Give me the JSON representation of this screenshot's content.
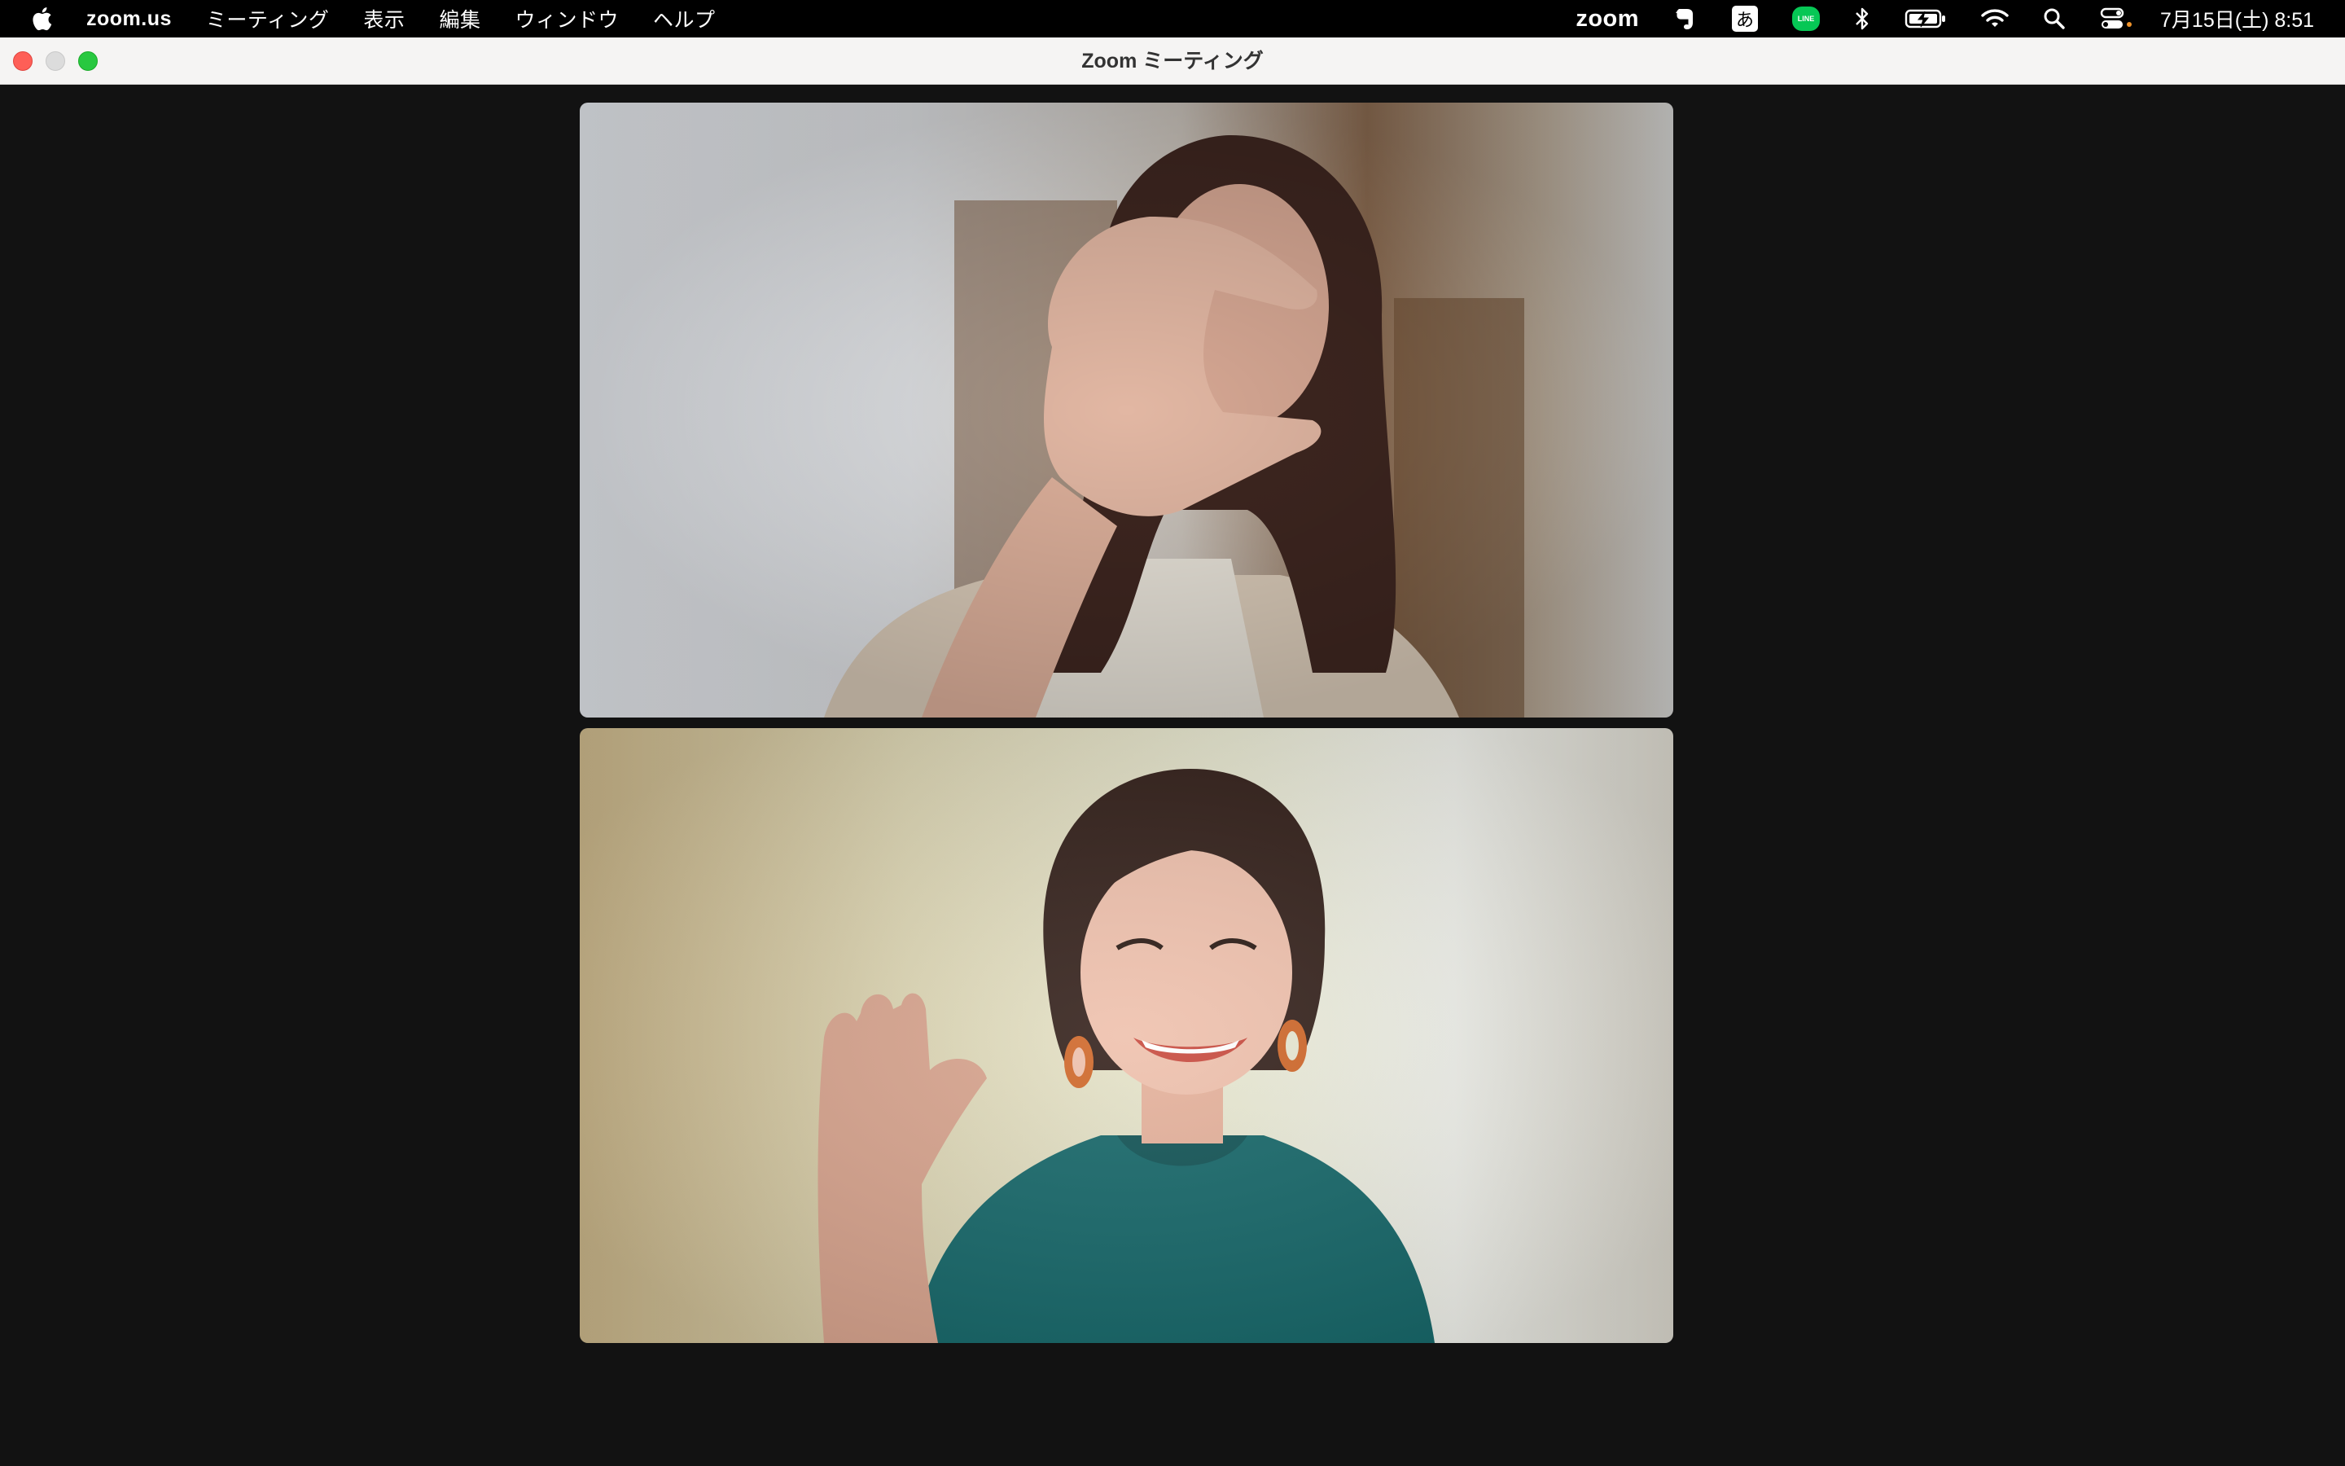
{
  "menubar": {
    "app_name": "zoom.us",
    "menus": [
      "ミーティング",
      "表示",
      "編集",
      "ウィンドウ",
      "ヘルプ"
    ],
    "status": {
      "zoom_label": "zoom",
      "ime_label": "あ",
      "line_label": "LINE",
      "clock": "7月15日(土)  8:51"
    }
  },
  "window": {
    "title": "Zoom ミーティング"
  },
  "participants": [
    {
      "description_icon": "participant-video"
    },
    {
      "description_icon": "participant-video"
    }
  ]
}
